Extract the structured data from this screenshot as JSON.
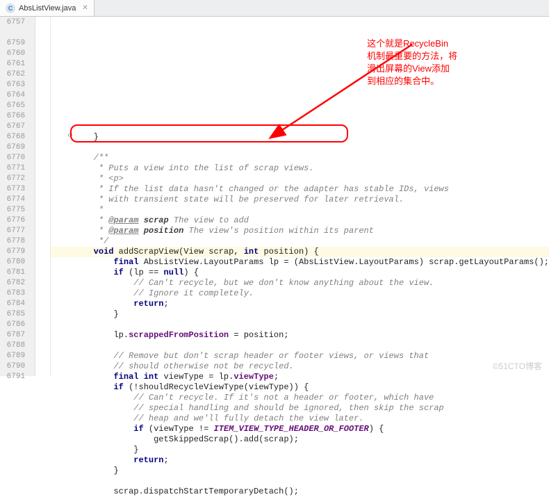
{
  "tab": {
    "filename": "AbsListView.java",
    "icon_letter": "C"
  },
  "line_start": 6757,
  "lines": [
    {
      "n": "6757",
      "tokens": [
        {
          "t": "        }",
          "c": ""
        }
      ]
    },
    {
      "n": "",
      "tokens": []
    },
    {
      "n": "6759",
      "tokens": [
        {
          "t": "        /**",
          "c": "cm"
        }
      ]
    },
    {
      "n": "6760",
      "tokens": [
        {
          "t": "         * Puts a view into the list of scrap views.",
          "c": "cm"
        }
      ]
    },
    {
      "n": "6761",
      "tokens": [
        {
          "t": "         * <p>",
          "c": "cm"
        }
      ]
    },
    {
      "n": "6762",
      "tokens": [
        {
          "t": "         * If the list data hasn't changed or the adapter has stable IDs, views",
          "c": "cm"
        }
      ]
    },
    {
      "n": "6763",
      "tokens": [
        {
          "t": "         * with transient state will be preserved for later retrieval.",
          "c": "cm"
        }
      ]
    },
    {
      "n": "6764",
      "tokens": [
        {
          "t": "         *",
          "c": "cm"
        }
      ]
    },
    {
      "n": "6765",
      "tokens": [
        {
          "t": "         * ",
          "c": "cm"
        },
        {
          "t": "@param",
          "c": "cmtag"
        },
        {
          "t": " ",
          "c": "cm"
        },
        {
          "t": "scrap",
          "c": "cmparam"
        },
        {
          "t": " The view to add",
          "c": "cm"
        }
      ]
    },
    {
      "n": "6766",
      "tokens": [
        {
          "t": "         * ",
          "c": "cm"
        },
        {
          "t": "@param",
          "c": "cmtag"
        },
        {
          "t": " ",
          "c": "cm"
        },
        {
          "t": "position",
          "c": "cmparam"
        },
        {
          "t": " The view's position within its parent",
          "c": "cm"
        }
      ]
    },
    {
      "n": "6767",
      "tokens": [
        {
          "t": "         */",
          "c": "cm"
        }
      ]
    },
    {
      "n": "6768",
      "hl": true,
      "tokens": [
        {
          "t": "        ",
          "c": ""
        },
        {
          "t": "void",
          "c": "kw"
        },
        {
          "t": " addScrapView(View scrap, ",
          "c": ""
        },
        {
          "t": "int",
          "c": "kw"
        },
        {
          "t": " position) {",
          "c": ""
        }
      ]
    },
    {
      "n": "6769",
      "tokens": [
        {
          "t": "            ",
          "c": ""
        },
        {
          "t": "final",
          "c": "kw"
        },
        {
          "t": " AbsListView.LayoutParams lp = (AbsListView.LayoutParams) scrap.getLayoutParams();",
          "c": ""
        }
      ]
    },
    {
      "n": "6770",
      "tokens": [
        {
          "t": "            ",
          "c": ""
        },
        {
          "t": "if",
          "c": "kw"
        },
        {
          "t": " (lp == ",
          "c": ""
        },
        {
          "t": "null",
          "c": "kw"
        },
        {
          "t": ") {",
          "c": ""
        }
      ]
    },
    {
      "n": "6771",
      "tokens": [
        {
          "t": "                // Can't recycle, but we don't know anything about the view.",
          "c": "cm"
        }
      ]
    },
    {
      "n": "6772",
      "tokens": [
        {
          "t": "                // Ignore it completely.",
          "c": "cm"
        }
      ]
    },
    {
      "n": "6773",
      "tokens": [
        {
          "t": "                ",
          "c": ""
        },
        {
          "t": "return",
          "c": "kw"
        },
        {
          "t": ";",
          "c": ""
        }
      ]
    },
    {
      "n": "6774",
      "tokens": [
        {
          "t": "            }",
          "c": ""
        }
      ]
    },
    {
      "n": "6775",
      "tokens": []
    },
    {
      "n": "6776",
      "tokens": [
        {
          "t": "            lp.",
          "c": ""
        },
        {
          "t": "scrappedFromPosition",
          "c": "field"
        },
        {
          "t": " = position;",
          "c": ""
        }
      ]
    },
    {
      "n": "6777",
      "tokens": []
    },
    {
      "n": "6778",
      "tokens": [
        {
          "t": "            // Remove but don't scrap header or footer views, or views that",
          "c": "cm"
        }
      ]
    },
    {
      "n": "6779",
      "tokens": [
        {
          "t": "            // should otherwise not be recycled.",
          "c": "cm"
        }
      ]
    },
    {
      "n": "6780",
      "tokens": [
        {
          "t": "            ",
          "c": ""
        },
        {
          "t": "final int",
          "c": "kw"
        },
        {
          "t": " viewType = lp.",
          "c": ""
        },
        {
          "t": "viewType",
          "c": "field"
        },
        {
          "t": ";",
          "c": ""
        }
      ]
    },
    {
      "n": "6781",
      "tokens": [
        {
          "t": "            ",
          "c": ""
        },
        {
          "t": "if",
          "c": "kw"
        },
        {
          "t": " (!shouldRecycleViewType(viewType)) {",
          "c": ""
        }
      ]
    },
    {
      "n": "6782",
      "tokens": [
        {
          "t": "                // Can't recycle. If it's not a header or footer, which have",
          "c": "cm"
        }
      ]
    },
    {
      "n": "6783",
      "tokens": [
        {
          "t": "                // special handling and should be ignored, then skip the scrap",
          "c": "cm"
        }
      ]
    },
    {
      "n": "6784",
      "tokens": [
        {
          "t": "                // heap and we'll fully detach the view later.",
          "c": "cm"
        }
      ]
    },
    {
      "n": "6785",
      "tokens": [
        {
          "t": "                ",
          "c": ""
        },
        {
          "t": "if",
          "c": "kw"
        },
        {
          "t": " (viewType != ",
          "c": ""
        },
        {
          "t": "ITEM_VIEW_TYPE_HEADER_OR_FOOTER",
          "c": "staticf"
        },
        {
          "t": ") {",
          "c": ""
        }
      ]
    },
    {
      "n": "6786",
      "tokens": [
        {
          "t": "                    getSkippedScrap().add(scrap);",
          "c": ""
        }
      ]
    },
    {
      "n": "6787",
      "tokens": [
        {
          "t": "                }",
          "c": ""
        }
      ]
    },
    {
      "n": "6788",
      "tokens": [
        {
          "t": "                ",
          "c": ""
        },
        {
          "t": "return",
          "c": "kw"
        },
        {
          "t": ";",
          "c": ""
        }
      ]
    },
    {
      "n": "6789",
      "tokens": [
        {
          "t": "            }",
          "c": ""
        }
      ]
    },
    {
      "n": "6790",
      "tokens": []
    },
    {
      "n": "6791",
      "tokens": [
        {
          "t": "            scrap.dispatchStartTemporaryDetach();",
          "c": ""
        }
      ]
    }
  ],
  "annotation": {
    "text": "这个就是RecycleBin\n机制最重要的方法，将\n滑出屏幕的View添加\n到相应的集合中。"
  },
  "watermark": "©51CTO博客",
  "colors": {
    "highlight_bg": "#fffae3",
    "red": "#ff0000",
    "comment": "#808080",
    "keyword": "#000080",
    "field": "#660e7a"
  }
}
